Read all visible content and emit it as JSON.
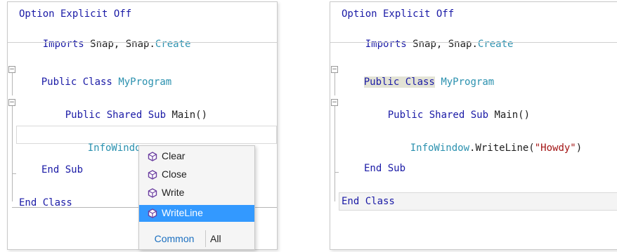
{
  "left_editor": {
    "line1": "Option Explicit Off",
    "line2_kw": "Imports",
    "line2_plain": " Snap, Snap.",
    "line2_ty": "Create",
    "class_kw": "Public Class",
    "class_name": "MyProgram",
    "sub_kw": "Public Shared Sub",
    "sub_name": " Main()",
    "typed_obj": "InfoWindow",
    "typed_dot": ".",
    "end_sub": "End Sub",
    "end_class": "End Class"
  },
  "completion": {
    "items": [
      {
        "label": "Clear",
        "icon": "method-cube-icon"
      },
      {
        "label": "Close",
        "icon": "method-cube-icon"
      },
      {
        "label": "Write",
        "icon": "method-cube-icon"
      },
      {
        "label": "WriteLine",
        "icon": "method-cube-icon",
        "selected": true
      }
    ],
    "tab_common": "Common",
    "tab_all": "All"
  },
  "right_editor": {
    "line1": "Option Explicit Off",
    "line2_kw": "Imports",
    "line2_plain": " Snap, Snap.",
    "line2_ty": "Create",
    "class_kw": "Public Class",
    "class_name": "MyProgram",
    "sub_kw": "Public Shared Sub",
    "sub_name": " Main()",
    "call_obj": "InfoWindow",
    "call_method": ".WriteLine(",
    "call_str": "\"Howdy\"",
    "call_close": ")",
    "end_sub": "End Sub",
    "end_class": "End Class"
  },
  "colors": {
    "keyword": "#1a1aa6",
    "type": "#2b91af",
    "string": "#a31515",
    "selection": "#3399ff"
  }
}
